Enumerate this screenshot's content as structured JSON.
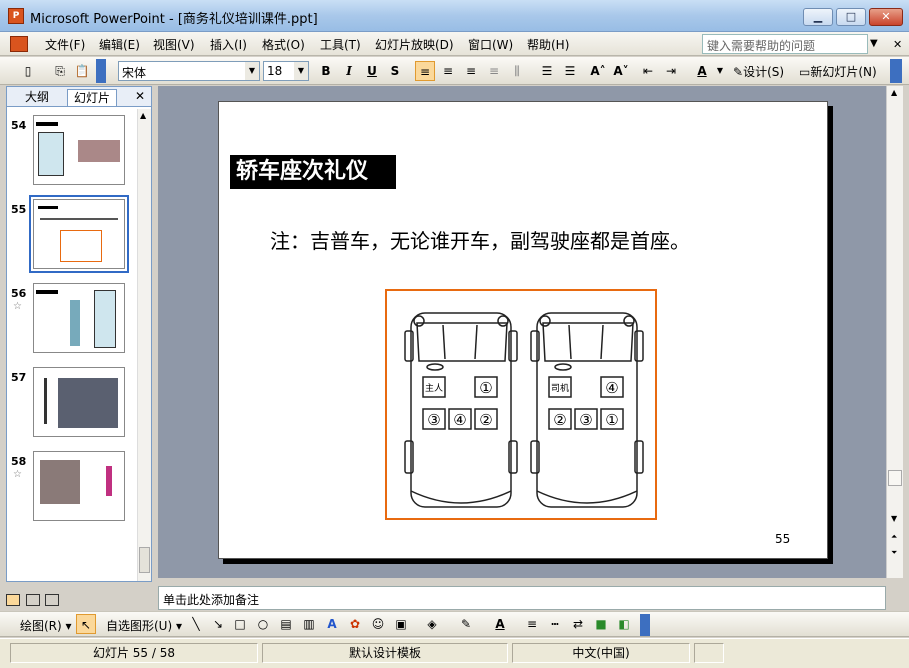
{
  "window": {
    "title": "Microsoft PowerPoint - [商务礼仪培训课件.ppt]",
    "min_label": "▁",
    "max_label": "□",
    "close_label": "✕"
  },
  "menubar": {
    "items": [
      "文件(F)",
      "编辑(E)",
      "视图(V)",
      "插入(I)",
      "格式(O)",
      "工具(T)",
      "幻灯片放映(D)",
      "窗口(W)",
      "帮助(H)"
    ],
    "help_placeholder": "键入需要帮助的问题"
  },
  "toolbar": {
    "font_name": "宋体",
    "font_size": "18",
    "bold": "B",
    "italic": "I",
    "underline": "U",
    "shadow": "S",
    "design_label": "设计(S)",
    "new_slide_label": "新幻灯片(N)"
  },
  "leftpane": {
    "tabs": [
      "大纲",
      "幻灯片"
    ],
    "close": "✕",
    "thumbnails": [
      {
        "number": "54",
        "star": false
      },
      {
        "number": "55",
        "star": false,
        "selected": true
      },
      {
        "number": "56",
        "star": true
      },
      {
        "number": "57",
        "star": false
      },
      {
        "number": "58",
        "star": true
      }
    ],
    "star_glyph": "☆"
  },
  "slide": {
    "title": "轿车座次礼仪",
    "note": "注：吉普车，无论谁开车，副驾驶座都是首座。",
    "page_number": "55",
    "diagram": {
      "car_left": {
        "driver_label": "主人",
        "front_seat": "①",
        "rear_seats": [
          "③",
          "④",
          "②"
        ]
      },
      "car_right": {
        "driver_label": "司机",
        "front_seat": "④",
        "rear_seats": [
          "②",
          "③",
          "①"
        ]
      }
    }
  },
  "notes": {
    "placeholder": "单击此处添加备注"
  },
  "drawbar": {
    "draw_label": "绘图(R)",
    "autoshape_label": "自选图形(U)"
  },
  "status": {
    "slide_pos": "幻灯片 55 / 58",
    "template": "默认设计模板",
    "language": "中文(中国)"
  },
  "colors": {
    "diagram_border": "#e86a10",
    "title_bg": "#000000",
    "work_bg": "#8f98a8"
  }
}
